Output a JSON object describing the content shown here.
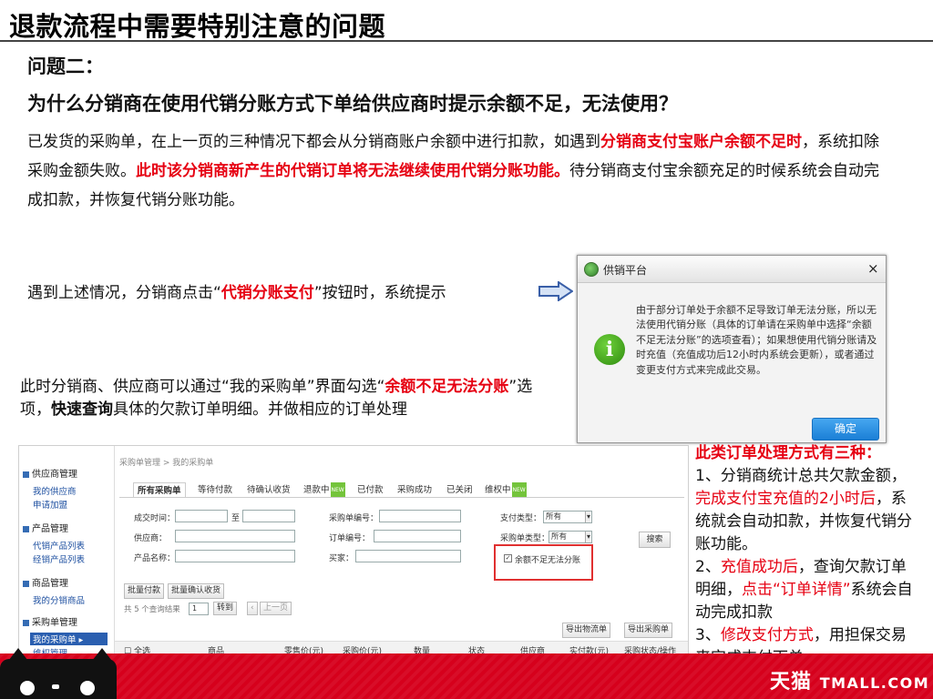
{
  "slide": {
    "title": "退款流程中需要特别注意的问题",
    "question_label": "问题二：",
    "question": "为什么分销商在使用代销分账方式下单给供应商时提示余额不足，无法使用？",
    "para_1": "已发货的采购单，在上一页的三种情况下都会从分销商账户余额中进行扣款，如遇到",
    "para_red_1": "分销商支付宝账户余额不足时",
    "para_2": "，系统扣除采购金额失败。",
    "para_red_2": "此时该分销商新产生的代销订单将无法继续使用代销分账功能。",
    "para_3": "待分销商支付宝余额充足的时候系统会自动完成扣款，并恢复代销分账功能。",
    "when_1": "遇到上述情况，分销商点击“",
    "when_red": "代销分账支付",
    "when_2": "”按钮时，系统提示",
    "now_1": "此时分销商、供应商可以通过“我的采购单”界面勾选“",
    "now_red": "余额不足无法分账",
    "now_2": "”选项，",
    "now_bold": "快速查询",
    "now_3": "具体的欠款订单明细。并做相应的订单处理"
  },
  "dialog": {
    "title": "供销平台",
    "close": "×",
    "message": "由于部分订单处于余额不足导致订单无法分账，所以无法使用代销分账（具体的订单请在采购单中选择“余额不足无法分账”的选项查看）；如果想使用代销分账请及时充值（充值成功后12小时内系统会更新），或者通过变更支付方式来完成此交易。",
    "ok": "确定"
  },
  "screenshot": {
    "sidebar": [
      {
        "group": "供应商管理",
        "links": [
          "我的供应商",
          "申请加盟"
        ]
      },
      {
        "group": "产品管理",
        "links": [
          "代销产品列表",
          "经销产品列表"
        ]
      },
      {
        "group": "商品管理",
        "links": [
          "我的分销商品"
        ]
      },
      {
        "group": "采购单管理",
        "links": [
          "我的采购单",
          "维权管理"
        ]
      }
    ],
    "breadcrumb": "采购单管理 > 我的采购单",
    "tabs": [
      "所有采购单",
      "等待付款",
      "待确认收货",
      "退款中",
      "已付款",
      "采购成功",
      "已关闭",
      "维权中"
    ],
    "new_badge": "NEW",
    "fields": {
      "created": "成交时间：",
      "to": "至",
      "po_no": "采购单编号：",
      "pay_type": "支付类型：",
      "pay_type_val": "所有",
      "supplier": "供应商：",
      "order_no": "订单编号：",
      "po_type": "采购单类型：",
      "po_type_val": "所有",
      "product": "产品名称：",
      "buyer": "买家：",
      "checkbox": "余额不足无法分账",
      "search": "搜索"
    },
    "buttons": {
      "batch_pay": "批量付款",
      "batch_confirm": "批量确认收货",
      "export_logistics": "导出物流单",
      "export_po": "导出采购单",
      "go": "转到",
      "prev": "上一页"
    },
    "pager": "共 5 个查询结果",
    "page_input": "1",
    "table_headers": [
      "全选",
      "商品",
      "零售价(元)",
      "采购价(元)",
      "数量",
      "状态",
      "供应商",
      "实付款(元)",
      "采购状态/操作"
    ]
  },
  "note": {
    "heading": "此类订单处理方式有三种：",
    "l1a": "1、分销商统计总共欠款金额，",
    "l1r": "完成支付宝充值的2小时后",
    "l1b": "，系统就会自动扣款，并恢复代销分账功能。",
    "l2a": "2、",
    "l2r": "充值成功后",
    "l2b": "，查询欠款订单明细，",
    "l2r2": "点击“订单详情”",
    "l2c": "系统会自动完成扣款",
    "l3a": "3、",
    "l3r": "修改支付方式",
    "l3b": "，用担保交易来完成支付下单"
  },
  "footer": {
    "brand_cn": "天猫",
    "brand_en": "TMALL.COM"
  },
  "colors": {
    "accent_red": "#e60012",
    "footer_red": "#d6001c",
    "dialog_button": "#1b7fd6"
  }
}
